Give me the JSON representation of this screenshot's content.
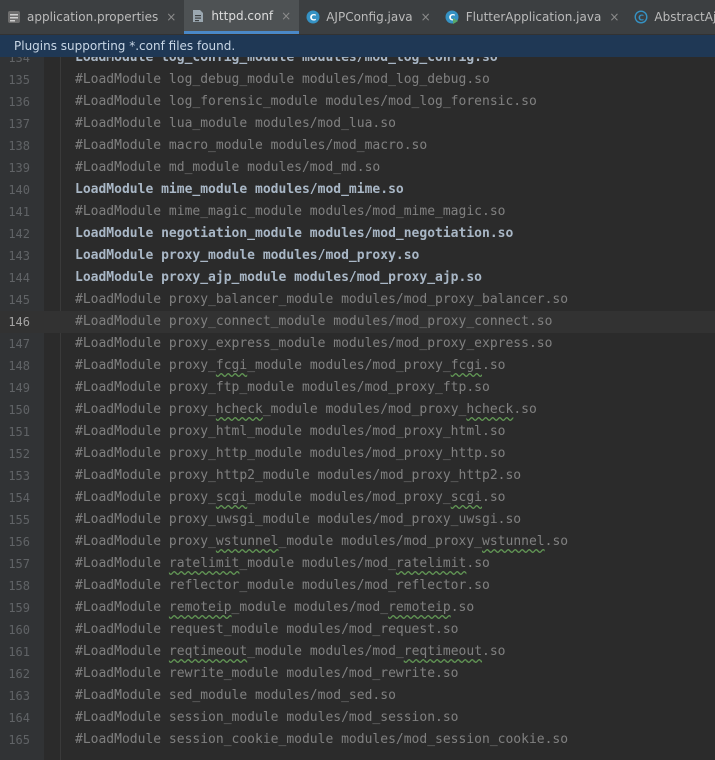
{
  "tabs": [
    {
      "label": "application.properties",
      "icon": "properties-file-icon",
      "active": false,
      "close": "×"
    },
    {
      "label": "httpd.conf",
      "icon": "text-file-icon",
      "active": true,
      "close": "×"
    },
    {
      "label": "AJPConfig.java",
      "icon": "java-class-icon",
      "active": false,
      "close": "×"
    },
    {
      "label": "FlutterApplication.java",
      "icon": "java-run-class-icon",
      "active": false,
      "close": "×"
    },
    {
      "label": "AbstractAjpProtocol.java",
      "icon": "java-abstract-class-icon",
      "active": false,
      "close": ""
    }
  ],
  "banner": {
    "text": "Plugins supporting *.conf files found."
  },
  "editor": {
    "current_line": 146,
    "lines": [
      {
        "n": 134,
        "text": "LoadModule log_config_module modules/mod_log_config.so",
        "commented": false,
        "wavy": ""
      },
      {
        "n": 135,
        "text": "#LoadModule log_debug_module modules/mod_log_debug.so",
        "commented": true,
        "wavy": ""
      },
      {
        "n": 136,
        "text": "#LoadModule log_forensic_module modules/mod_log_forensic.so",
        "commented": true,
        "wavy": ""
      },
      {
        "n": 137,
        "text": "#LoadModule lua_module modules/mod_lua.so",
        "commented": true,
        "wavy": ""
      },
      {
        "n": 138,
        "text": "#LoadModule macro_module modules/mod_macro.so",
        "commented": true,
        "wavy": ""
      },
      {
        "n": 139,
        "text": "#LoadModule md_module modules/mod_md.so",
        "commented": true,
        "wavy": ""
      },
      {
        "n": 140,
        "text": "LoadModule mime_module modules/mod_mime.so",
        "commented": false,
        "wavy": ""
      },
      {
        "n": 141,
        "text": "#LoadModule mime_magic_module modules/mod_mime_magic.so",
        "commented": true,
        "wavy": ""
      },
      {
        "n": 142,
        "text": "LoadModule negotiation_module modules/mod_negotiation.so",
        "commented": false,
        "wavy": ""
      },
      {
        "n": 143,
        "text": "LoadModule proxy_module modules/mod_proxy.so",
        "commented": false,
        "wavy": ""
      },
      {
        "n": 144,
        "text": "LoadModule proxy_ajp_module modules/mod_proxy_ajp.so",
        "commented": false,
        "wavy": ""
      },
      {
        "n": 145,
        "text": "#LoadModule proxy_balancer_module modules/mod_proxy_balancer.so",
        "commented": true,
        "wavy": ""
      },
      {
        "n": 146,
        "text": "#LoadModule proxy_connect_module modules/mod_proxy_connect.so",
        "commented": true,
        "wavy": ""
      },
      {
        "n": 147,
        "text": "#LoadModule proxy_express_module modules/mod_proxy_express.so",
        "commented": true,
        "wavy": ""
      },
      {
        "n": 148,
        "text": "#LoadModule proxy_fcgi_module modules/mod_proxy_fcgi.so",
        "commented": true,
        "wavy": "fcgi"
      },
      {
        "n": 149,
        "text": "#LoadModule proxy_ftp_module modules/mod_proxy_ftp.so",
        "commented": true,
        "wavy": ""
      },
      {
        "n": 150,
        "text": "#LoadModule proxy_hcheck_module modules/mod_proxy_hcheck.so",
        "commented": true,
        "wavy": "hcheck"
      },
      {
        "n": 151,
        "text": "#LoadModule proxy_html_module modules/mod_proxy_html.so",
        "commented": true,
        "wavy": ""
      },
      {
        "n": 152,
        "text": "#LoadModule proxy_http_module modules/mod_proxy_http.so",
        "commented": true,
        "wavy": ""
      },
      {
        "n": 153,
        "text": "#LoadModule proxy_http2_module modules/mod_proxy_http2.so",
        "commented": true,
        "wavy": ""
      },
      {
        "n": 154,
        "text": "#LoadModule proxy_scgi_module modules/mod_proxy_scgi.so",
        "commented": true,
        "wavy": "scgi"
      },
      {
        "n": 155,
        "text": "#LoadModule proxy_uwsgi_module modules/mod_proxy_uwsgi.so",
        "commented": true,
        "wavy": ""
      },
      {
        "n": 156,
        "text": "#LoadModule proxy_wstunnel_module modules/mod_proxy_wstunnel.so",
        "commented": true,
        "wavy": "wstunnel"
      },
      {
        "n": 157,
        "text": "#LoadModule ratelimit_module modules/mod_ratelimit.so",
        "commented": true,
        "wavy": "ratelimit"
      },
      {
        "n": 158,
        "text": "#LoadModule reflector_module modules/mod_reflector.so",
        "commented": true,
        "wavy": ""
      },
      {
        "n": 159,
        "text": "#LoadModule remoteip_module modules/mod_remoteip.so",
        "commented": true,
        "wavy": "remoteip"
      },
      {
        "n": 160,
        "text": "#LoadModule request_module modules/mod_request.so",
        "commented": true,
        "wavy": ""
      },
      {
        "n": 161,
        "text": "#LoadModule reqtimeout_module modules/mod_reqtimeout.so",
        "commented": true,
        "wavy": "reqtimeout"
      },
      {
        "n": 162,
        "text": "#LoadModule rewrite_module modules/mod_rewrite.so",
        "commented": true,
        "wavy": ""
      },
      {
        "n": 163,
        "text": "#LoadModule sed_module modules/mod_sed.so",
        "commented": true,
        "wavy": ""
      },
      {
        "n": 164,
        "text": "#LoadModule session_module modules/mod_session.so",
        "commented": true,
        "wavy": ""
      },
      {
        "n": 165,
        "text": "#LoadModule session_cookie_module modules/mod_session_cookie.so",
        "commented": true,
        "wavy": ""
      }
    ]
  }
}
